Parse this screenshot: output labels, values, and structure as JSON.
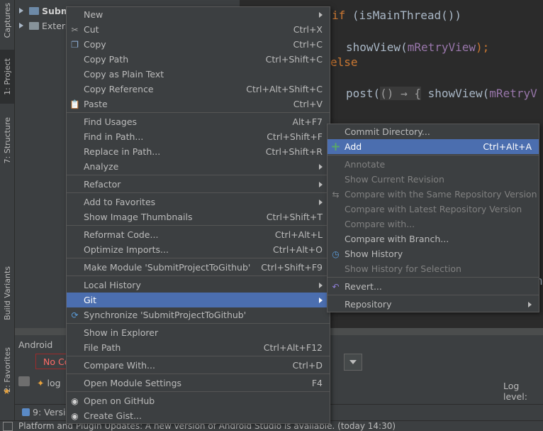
{
  "sidebar_tabs": {
    "captures": "Captures",
    "project": "1: Project",
    "structure": "7: Structure",
    "build_variants": "Build Variants",
    "favorites": "2: Favorites"
  },
  "project_tree": {
    "root": "Subm",
    "external": "Extern"
  },
  "editor": {
    "line1_kw": "if",
    "line1_rest": " (isMainThread())",
    "line2_fn": "showView(",
    "line2_fld": "mRetryView",
    "line2_end": ");",
    "line3": "else",
    "line4_fn": "post(",
    "line4_fold": "() → {",
    "line4_fn2": " showView(",
    "line4_fld": "mRetryV",
    "line5": "n"
  },
  "android_panel": {
    "title": "Android",
    "device_combo": "No Co",
    "log_tab": "log",
    "log_level": "Log level:"
  },
  "bottom_toolbar": {
    "version_control": "9: Versio"
  },
  "status_bar": {
    "text": "Platform and Plugin Updates: A new version of Android Studio is available. (today 14:30)"
  },
  "context_menu": {
    "groups": [
      [
        {
          "label": "New",
          "shortcut": "",
          "submenu": true,
          "icon": ""
        },
        {
          "label": "Cut",
          "shortcut": "Ctrl+X",
          "icon": "scissors-icon"
        },
        {
          "label": "Copy",
          "shortcut": "Ctrl+C",
          "icon": "copy-icon"
        },
        {
          "label": "Copy Path",
          "shortcut": "Ctrl+Shift+C",
          "icon": ""
        },
        {
          "label": "Copy as Plain Text",
          "shortcut": "",
          "icon": ""
        },
        {
          "label": "Copy Reference",
          "shortcut": "Ctrl+Alt+Shift+C",
          "icon": ""
        },
        {
          "label": "Paste",
          "shortcut": "Ctrl+V",
          "icon": "paste-icon"
        }
      ],
      [
        {
          "label": "Find Usages",
          "shortcut": "Alt+F7",
          "icon": ""
        },
        {
          "label": "Find in Path...",
          "shortcut": "Ctrl+Shift+F",
          "icon": ""
        },
        {
          "label": "Replace in Path...",
          "shortcut": "Ctrl+Shift+R",
          "icon": ""
        },
        {
          "label": "Analyze",
          "shortcut": "",
          "submenu": true,
          "icon": ""
        }
      ],
      [
        {
          "label": "Refactor",
          "shortcut": "",
          "submenu": true,
          "icon": ""
        }
      ],
      [
        {
          "label": "Add to Favorites",
          "shortcut": "",
          "submenu": true,
          "icon": ""
        },
        {
          "label": "Show Image Thumbnails",
          "shortcut": "Ctrl+Shift+T",
          "icon": ""
        }
      ],
      [
        {
          "label": "Reformat Code...",
          "shortcut": "Ctrl+Alt+L",
          "icon": ""
        },
        {
          "label": "Optimize Imports...",
          "shortcut": "Ctrl+Alt+O",
          "icon": ""
        }
      ],
      [
        {
          "label": "Make Module 'SubmitProjectToGithub'",
          "shortcut": "Ctrl+Shift+F9",
          "icon": ""
        }
      ],
      [
        {
          "label": "Local History",
          "shortcut": "",
          "submenu": true,
          "icon": ""
        },
        {
          "label": "Git",
          "shortcut": "",
          "submenu": true,
          "icon": "",
          "selected": true
        },
        {
          "label": "Synchronize 'SubmitProjectToGithub'",
          "shortcut": "",
          "icon": "sync-icon"
        }
      ],
      [
        {
          "label": "Show in Explorer",
          "shortcut": "",
          "icon": ""
        },
        {
          "label": "File Path",
          "shortcut": "Ctrl+Alt+F12",
          "icon": ""
        }
      ],
      [
        {
          "label": "Compare With...",
          "shortcut": "Ctrl+D",
          "icon": ""
        }
      ],
      [
        {
          "label": "Open Module Settings",
          "shortcut": "F4",
          "icon": ""
        }
      ],
      [
        {
          "label": "Open on GitHub",
          "shortcut": "",
          "icon": "github-icon"
        },
        {
          "label": "Create Gist...",
          "shortcut": "",
          "icon": "github-icon"
        }
      ]
    ]
  },
  "git_submenu": {
    "groups": [
      [
        {
          "label": "Commit Directory...",
          "shortcut": "",
          "icon": ""
        },
        {
          "label": "Add",
          "shortcut": "Ctrl+Alt+A",
          "icon": "plus-icon",
          "selected": true
        }
      ],
      [
        {
          "label": "Annotate",
          "shortcut": "",
          "icon": "",
          "disabled": true
        },
        {
          "label": "Show Current Revision",
          "shortcut": "",
          "icon": "",
          "disabled": true
        },
        {
          "label": "Compare with the Same Repository Version",
          "shortcut": "",
          "icon": "compare-icon",
          "disabled": true
        },
        {
          "label": "Compare with Latest Repository Version",
          "shortcut": "",
          "icon": "",
          "disabled": true
        },
        {
          "label": "Compare with...",
          "shortcut": "",
          "icon": "",
          "disabled": true
        },
        {
          "label": "Compare with Branch...",
          "shortcut": "",
          "icon": ""
        },
        {
          "label": "Show History",
          "shortcut": "",
          "icon": "history-icon"
        },
        {
          "label": "Show History for Selection",
          "shortcut": "",
          "icon": "",
          "disabled": true
        }
      ],
      [
        {
          "label": "Revert...",
          "shortcut": "",
          "icon": "revert-icon"
        }
      ],
      [
        {
          "label": "Repository",
          "shortcut": "",
          "submenu": true,
          "icon": ""
        }
      ]
    ]
  }
}
